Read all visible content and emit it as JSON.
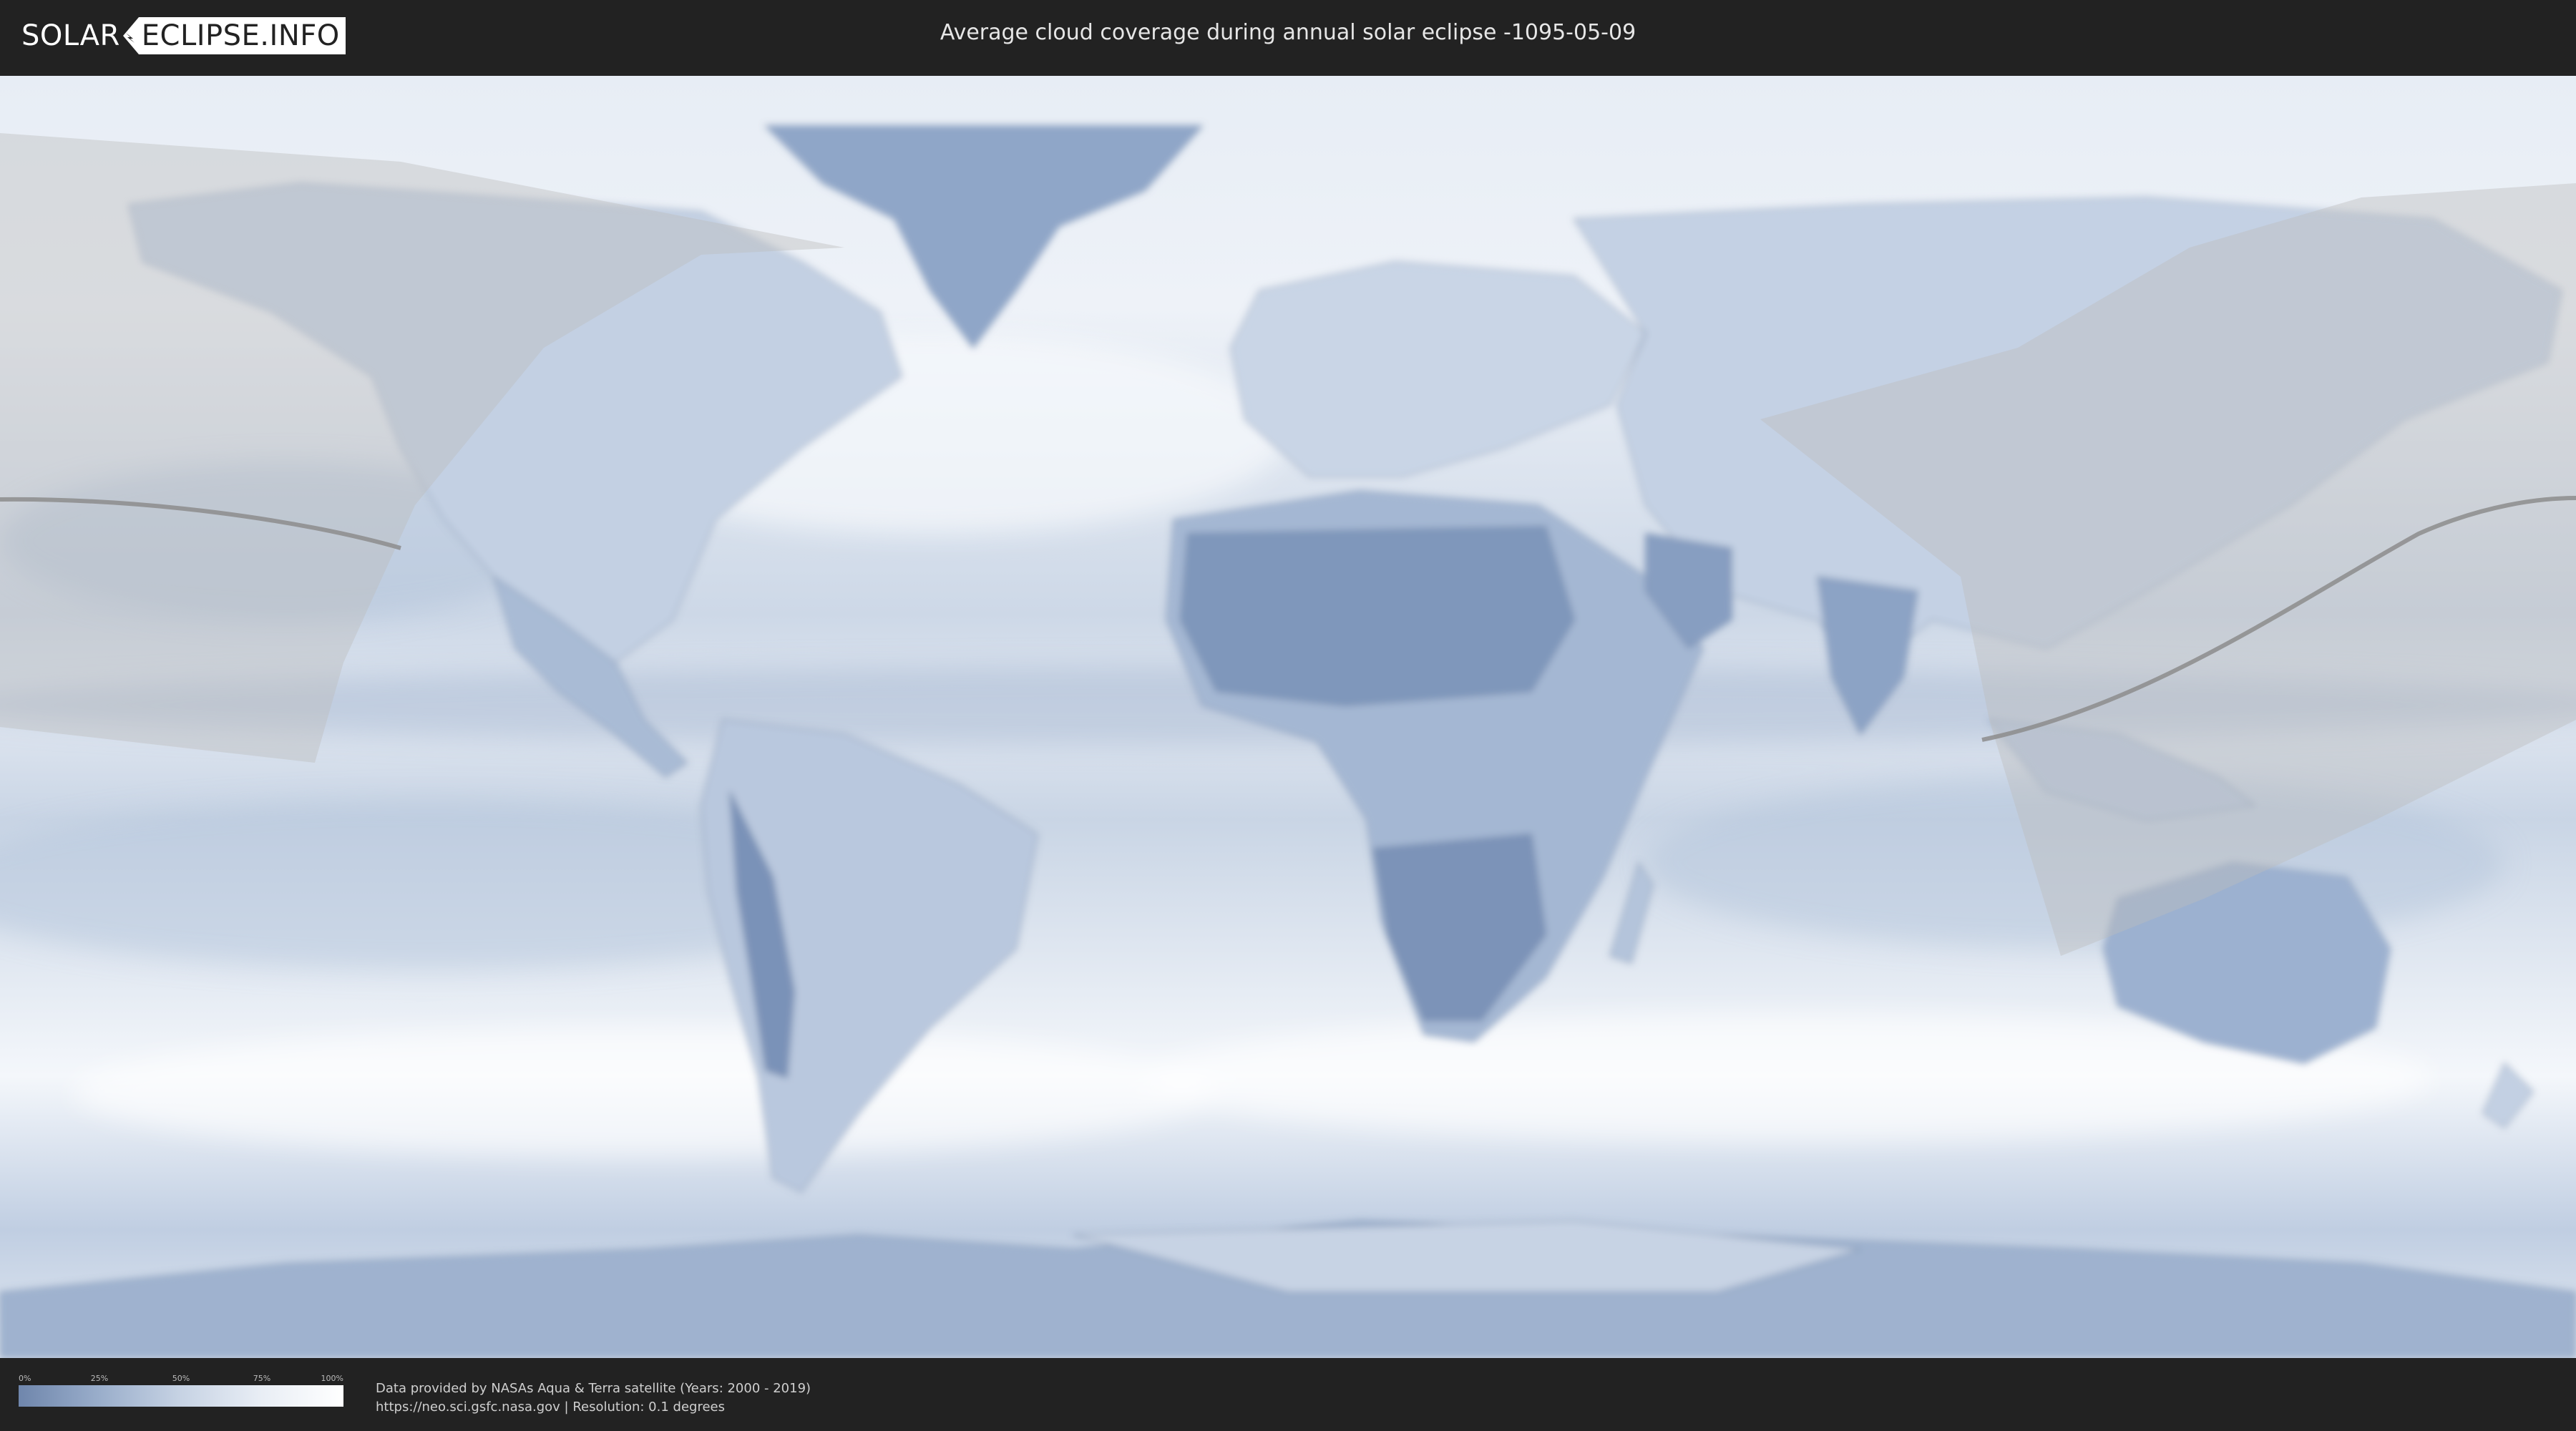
{
  "header": {
    "logo_left": "SOLAR",
    "logo_right": "ECLIPSE.INFO",
    "title": "Average cloud coverage during annual solar eclipse -1095-05-09"
  },
  "legend": {
    "ticks": [
      "0%",
      "25%",
      "50%",
      "75%",
      "100%"
    ],
    "colors": [
      "#6f86ac",
      "#9aaecb",
      "#c7d3e4",
      "#e9eef5",
      "#ffffff"
    ]
  },
  "credits": {
    "line1": "Data provided by NASAs Aqua & Terra satellite (Years: 2000 - 2019)",
    "line2": "https://neo.sci.gsfc.nasa.gov | Resolution: 0.1 degrees"
  },
  "map": {
    "colors": {
      "ocean_base": "#d5deea",
      "cloud_clear": "#f4f7fb",
      "land_dark": "#7f97bb",
      "eclipse_zone": "#bfbfbf",
      "path_line": "#8c8c8c"
    }
  }
}
